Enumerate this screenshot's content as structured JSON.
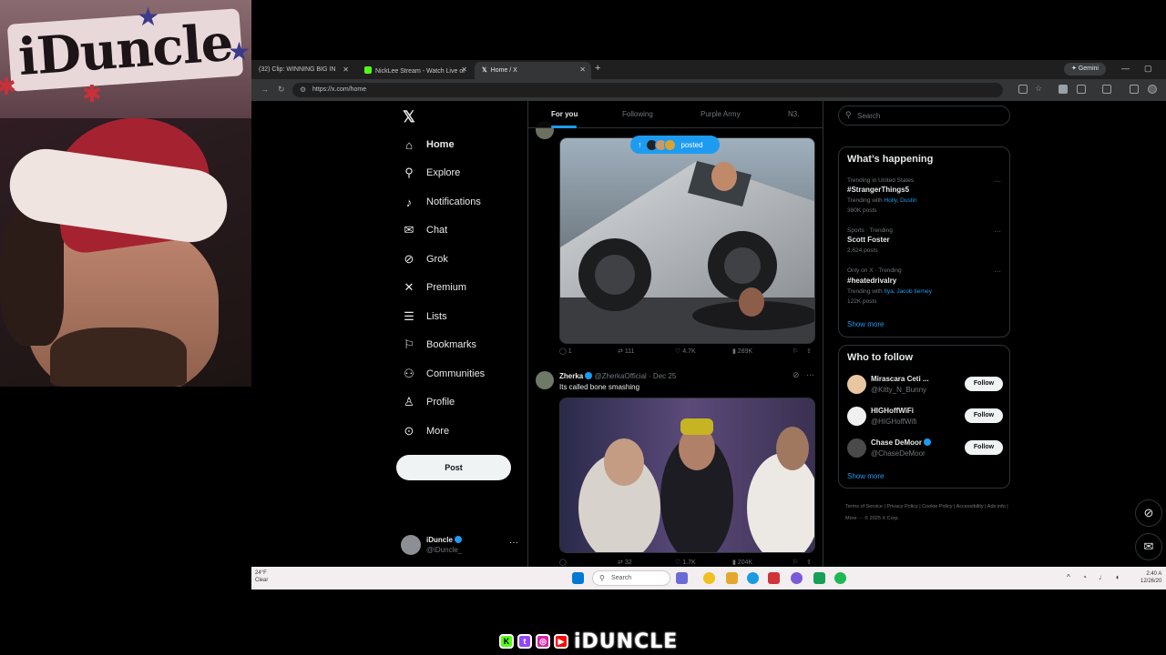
{
  "stream": {
    "sign_text": "iDuncle",
    "banner_name": "iDUNCLE",
    "social_icons": [
      "kick-icon",
      "twitch-icon",
      "instagram-icon",
      "youtube-icon"
    ]
  },
  "browser": {
    "tabs": [
      {
        "label": "(32) Clip: WINNING BIG IN",
        "active": false
      },
      {
        "label": "NickLee Stream - Watch Live or",
        "active": false
      },
      {
        "label": "Home / X",
        "active": true
      }
    ],
    "new_tab": "+",
    "gemini_label": "Gemini",
    "url": "https://x.com/home"
  },
  "x": {
    "nav": [
      {
        "label": "Home",
        "icon": "home-icon"
      },
      {
        "label": "Explore",
        "icon": "search-icon"
      },
      {
        "label": "Notifications",
        "icon": "bell-icon"
      },
      {
        "label": "Chat",
        "icon": "mail-icon"
      },
      {
        "label": "Grok",
        "icon": "grok-icon"
      },
      {
        "label": "Premium",
        "icon": "x-icon"
      },
      {
        "label": "Lists",
        "icon": "list-icon"
      },
      {
        "label": "Bookmarks",
        "icon": "bookmark-icon"
      },
      {
        "label": "Communities",
        "icon": "people-icon"
      },
      {
        "label": "Profile",
        "icon": "person-icon"
      },
      {
        "label": "More",
        "icon": "more-circle-icon"
      }
    ],
    "post_button": "Post",
    "account": {
      "name": "iDuncle",
      "handle": "@iDuncle_"
    },
    "feed_tabs": [
      "For you",
      "Following",
      "Purple Army",
      "N3."
    ],
    "posted_pill": "posted",
    "tweets": [
      {
        "actions": {
          "replies": "1",
          "reposts": "111",
          "likes": "4.7K",
          "views": "289K"
        }
      },
      {
        "name": "Zherka",
        "handle": "@ZherkaOfficial",
        "date": "Dec 25",
        "text": "Its called bone smashing",
        "actions": {
          "replies": "",
          "reposts": "32",
          "likes": "1.7K",
          "views": "204K"
        }
      }
    ],
    "search_placeholder": "Search",
    "whats_happening": {
      "title": "What’s happening",
      "trends": [
        {
          "meta": "Trending in United States",
          "name": "#StrangerThings5",
          "with_prefix": "Trending with",
          "with": "Holly, Dustin",
          "posts": "380K posts"
        },
        {
          "meta": "Sports · Trending",
          "name": "Scott Foster",
          "with_prefix": "",
          "with": "",
          "posts": "2,624 posts"
        },
        {
          "meta": "Only on X · Trending",
          "name": "#heatedrivalry",
          "with_prefix": "Trending with",
          "with": "Ilya, Jacob tierney",
          "posts": "122K posts"
        }
      ],
      "show_more": "Show more"
    },
    "who_to_follow": {
      "title": "Who to follow",
      "accounts": [
        {
          "name": "Mirascara Ceti ...",
          "handle": "@Kitty_N_Bunny",
          "button": "Follow"
        },
        {
          "name": "HIGHoffWiFi",
          "handle": "@HIGHoffWifi",
          "button": "Follow"
        },
        {
          "name": "Chase DeMoor",
          "handle": "@ChaseDeMoor",
          "button": "Follow"
        }
      ],
      "show_more": "Show more"
    },
    "footer": "Terms of Service  |  Privacy Policy  |  Cookie Policy  |  Accessibility  |  Ads info  |  More ···  © 2025 X Corp."
  },
  "taskbar": {
    "weather_temp": "24°F",
    "weather_desc": "Clear",
    "search_label": "Search",
    "time": "2:40 A",
    "date": "12/26/20"
  }
}
